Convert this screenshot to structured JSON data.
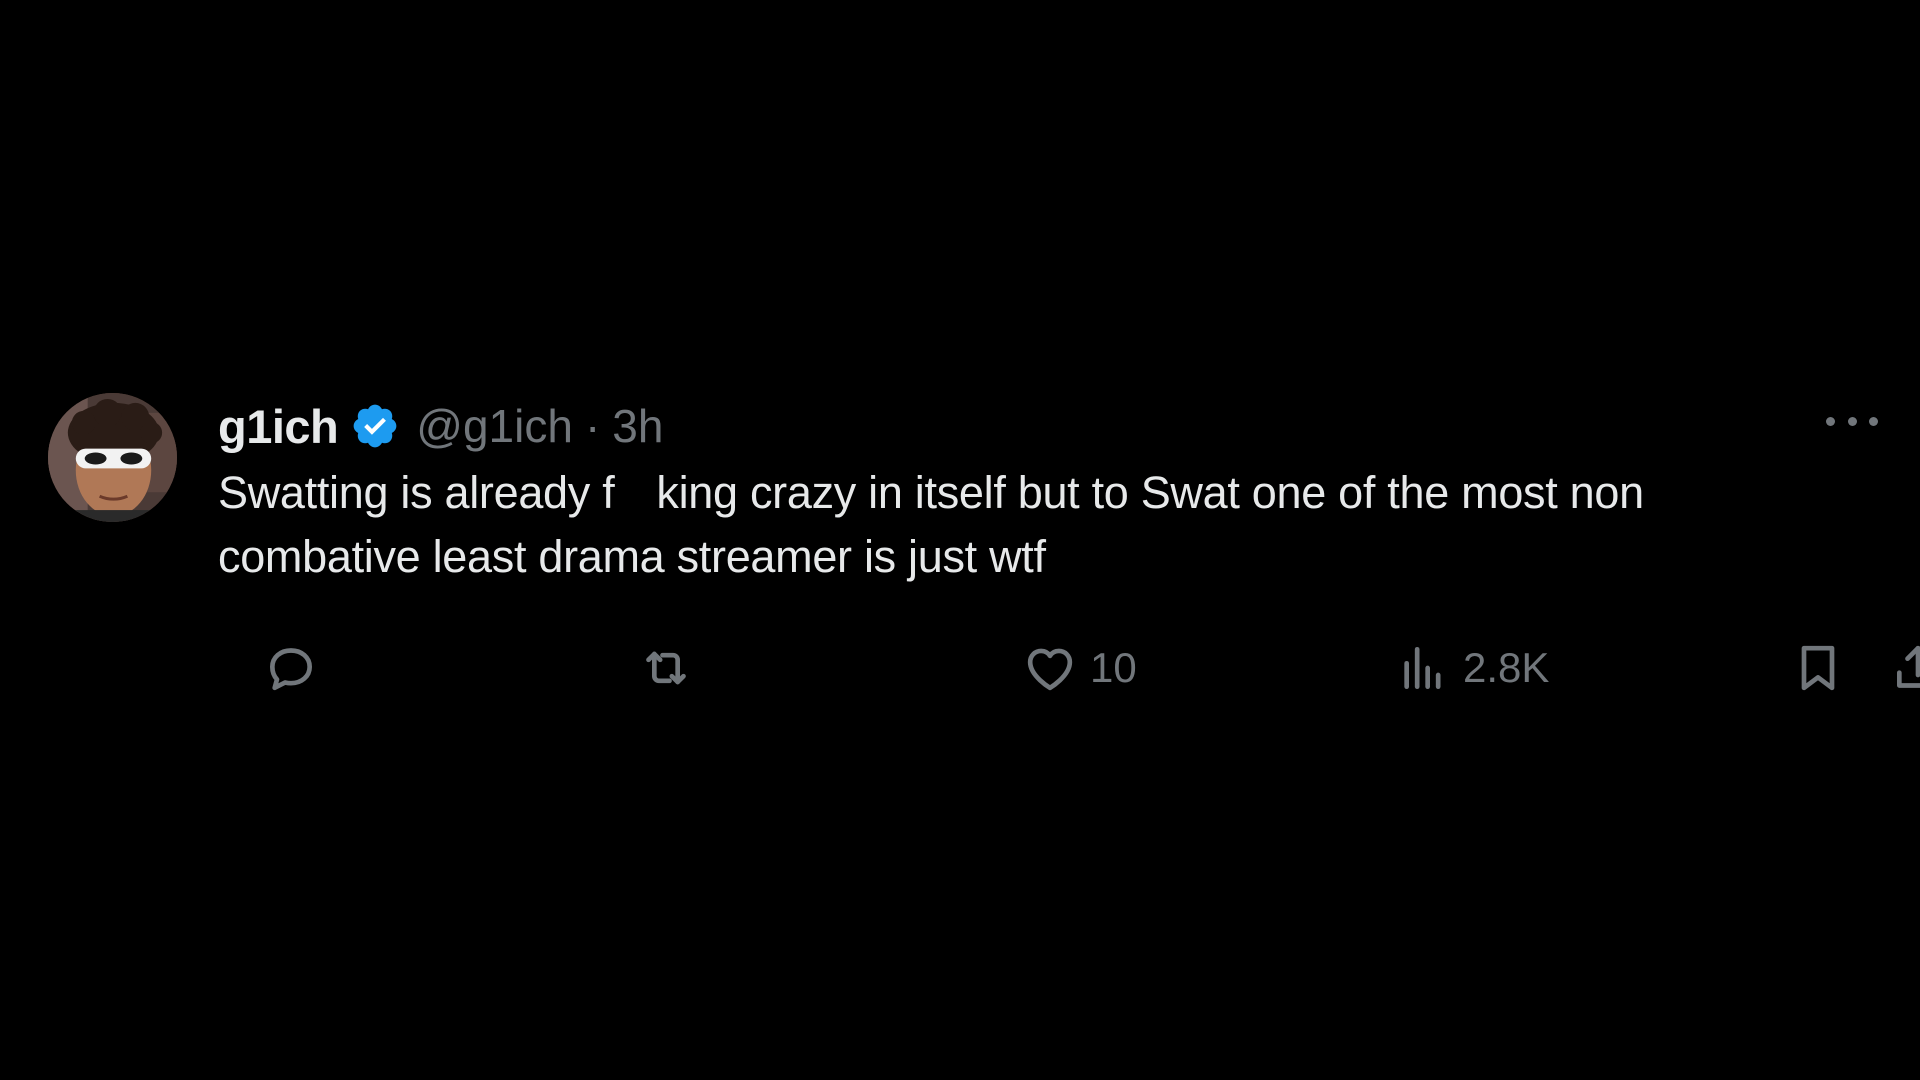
{
  "tweet": {
    "display_name": "g1ich",
    "handle": "@g1ich",
    "separator": "·",
    "time": "3h",
    "verified": true,
    "text_part1": "Swatting is already f",
    "text_part2": "king crazy in itself but to Swat one of the most non combative least drama streamer is just wtf"
  },
  "actions": {
    "reply_icon": "reply-icon",
    "retweet_icon": "retweet-icon",
    "like_icon": "heart-icon",
    "like_count": "10",
    "views_icon": "views-icon",
    "views_count": "2.8K",
    "bookmark_icon": "bookmark-icon",
    "share_icon": "share-icon"
  },
  "colors": {
    "background": "#000000",
    "text": "#e7e9ea",
    "secondary": "#71767b",
    "verified": "#1d9bf0"
  }
}
